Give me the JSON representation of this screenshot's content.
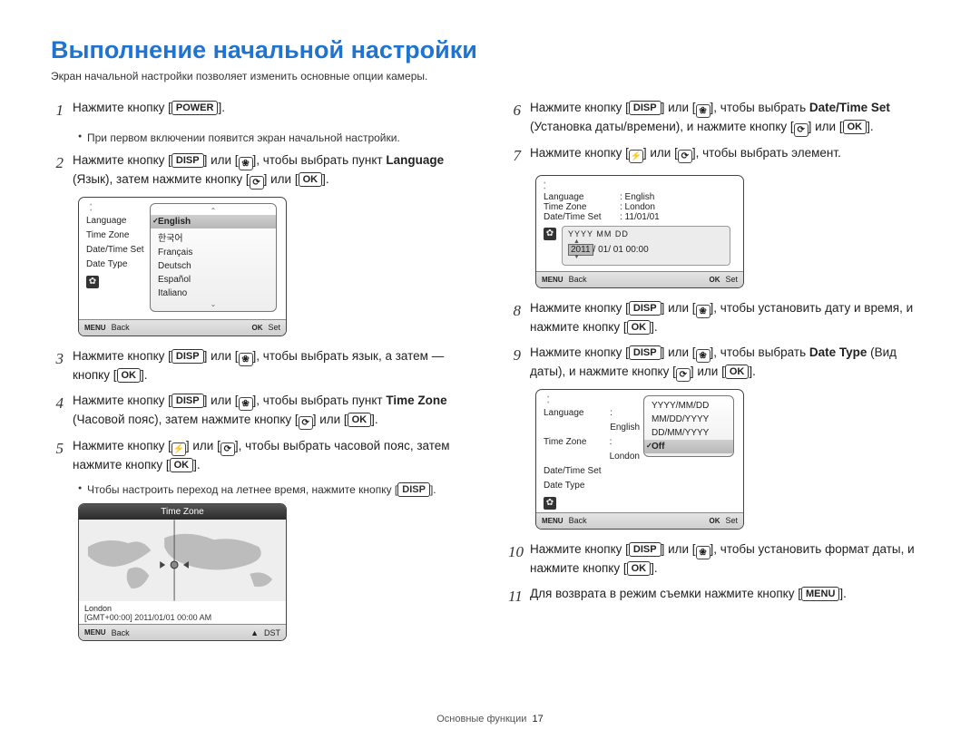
{
  "title": "Выполнение начальной настройки",
  "subtitle": "Экран начальной настройки позволяет изменить основные опции камеры.",
  "buttons": {
    "power": "POWER",
    "disp": "DISP",
    "ok": "OK",
    "menu": "MENU"
  },
  "glyphs": {
    "macro": "❀",
    "timer": "⟳",
    "flash": "⚡"
  },
  "steps_left": [
    {
      "n": "1",
      "text": "Нажмите кнопку [{POWER}]."
    },
    {
      "n": "",
      "bullet": "При первом включении появится экран начальной настройки."
    },
    {
      "n": "2",
      "text": "Нажмите кнопку [{DISP}] или [{MACRO}], чтобы выбрать пункт <b>Language</b> (Язык), затем нажмите кнопку [{TIMER}] или [{OK}]."
    },
    {
      "n": "3",
      "text": "Нажмите кнопку [{DISP}] или [{MACRO}], чтобы выбрать язык, а затем — кнопку [{OK}]."
    },
    {
      "n": "4",
      "text": "Нажмите кнопку [{DISP}] или [{MACRO}], чтобы выбрать пункт <b>Time Zone</b> (Часовой пояс), затем нажмите кнопку [{TIMER}] или [{OK}]."
    },
    {
      "n": "5",
      "text": "Нажмите кнопку [{FLASH}] или [{TIMER}], чтобы выбрать часовой пояс, затем нажмите кнопку [{OK}]."
    },
    {
      "n": "",
      "bullet": "Чтобы настроить переход на летнее время, нажмите кнопку [{DISP}]."
    }
  ],
  "steps_right": [
    {
      "n": "6",
      "text": "Нажмите кнопку [{DISP}] или [{MACRO}], чтобы выбрать <b>Date/Time Set</b> (Установка даты/времени), и нажмите кнопку [{TIMER}] или [{OK}]."
    },
    {
      "n": "7",
      "text": "Нажмите кнопку [{FLASH}] или [{TIMER}], чтобы выбрать элемент."
    },
    {
      "n": "8",
      "text": "Нажмите кнопку [{DISP}] или [{MACRO}], чтобы установить дату и время, и нажмите кнопку [{OK}]."
    },
    {
      "n": "9",
      "text": "Нажмите кнопку [{DISP}] или [{MACRO}], чтобы выбрать <b>Date Type</b> (Вид даты), и нажмите кнопку [{TIMER}] или [{OK}]."
    },
    {
      "n": "10",
      "text": "Нажмите кнопку [{DISP}] или [{MACRO}], чтобы установить формат даты, и нажмите кнопку [{OK}]."
    },
    {
      "n": "11",
      "text": "Для возврата в режим съемки нажмите кнопку [{MENU}]."
    }
  ],
  "screen_lang": {
    "side": [
      "Language",
      "Time Zone",
      "Date/Time Set",
      "Date Type"
    ],
    "options": [
      "English",
      "한국어",
      "Français",
      "Deutsch",
      "Español",
      "Italiano"
    ],
    "selected": "English",
    "foot_back_tag": "MENU",
    "foot_back": "Back",
    "foot_set_tag": "OK",
    "foot_set": "Set"
  },
  "screen_tz": {
    "title": "Time Zone",
    "city": "London",
    "detail": "[GMT+00:00]    2011/01/01    00:00 AM",
    "foot_back_tag": "MENU",
    "foot_back": "Back",
    "foot_dst": "DST"
  },
  "screen_dts": {
    "rows": [
      {
        "k": "Language",
        "v": ": English"
      },
      {
        "k": "Time Zone",
        "v": ": London"
      },
      {
        "k": "Date/Time Set",
        "v": ": 11/01/01"
      }
    ],
    "datebox_hdr": "YYYY MM DD",
    "datebox_year": "2011",
    "datebox_rest": "/ 01/ 01  00:00",
    "foot_back_tag": "MENU",
    "foot_back": "Back",
    "foot_set_tag": "OK",
    "foot_set": "Set"
  },
  "screen_type": {
    "side": [
      "Language",
      "Time Zone",
      "Date/Time Set",
      "Date Type"
    ],
    "sidev": [
      ": English",
      ": London",
      "",
      ""
    ],
    "options": [
      "YYYY/MM/DD",
      "MM/DD/YYYY",
      "DD/MM/YYYY",
      "Off"
    ],
    "selected": "Off",
    "foot_back_tag": "MENU",
    "foot_back": "Back",
    "foot_set_tag": "OK",
    "foot_set": "Set"
  },
  "footer": {
    "section": "Основные функции",
    "page": "17"
  }
}
